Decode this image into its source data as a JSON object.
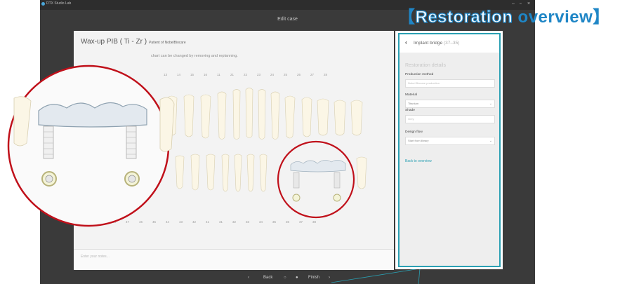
{
  "app": {
    "name": "DTX Studio Lab",
    "window_title": "Edit case"
  },
  "window_controls": {
    "minimize": "–",
    "maximize": "▫",
    "close": "×"
  },
  "case": {
    "title": "Wax-up PIB ( Ti - Zr )",
    "patient": "Patient of NobelBiocare",
    "subtitle": "chart can be changed by removing and replanning.",
    "upper_teeth": [
      "13",
      "14",
      "15",
      "16",
      "11",
      "21",
      "22",
      "23",
      "24",
      "25",
      "26",
      "27",
      "28"
    ],
    "lower_teeth": [
      "48",
      "47",
      "46",
      "45",
      "44",
      "43",
      "42",
      "41",
      "31",
      "32",
      "33",
      "34",
      "35",
      "36",
      "37",
      "38"
    ],
    "notes_placeholder": "Enter your notes..."
  },
  "panel": {
    "header_label": "Implant bridge",
    "header_range": "(37–35)",
    "section_title": "Restoration details",
    "fields": [
      {
        "label": "Production method",
        "value": "Nobel Biocare production",
        "placeholder": true
      },
      {
        "label": "Material",
        "value": "Titanium",
        "dropdown": true
      },
      {
        "label": "Shade",
        "value": "Grey",
        "placeholder": true
      },
      {
        "label": "Design flow",
        "value": "Start from library",
        "dropdown": true
      }
    ],
    "back_link": "Back to overview"
  },
  "nav": {
    "back": "Back",
    "finish": "Finish"
  },
  "annotation": {
    "title_bracket_open": "【",
    "title_word": "Restoration",
    "title_rest": "overview",
    "title_bracket_close": "】"
  },
  "colors": {
    "accent": "#2aa0b3",
    "annotation_red": "#c0101a",
    "annotation_blue": "#1f86c6"
  }
}
